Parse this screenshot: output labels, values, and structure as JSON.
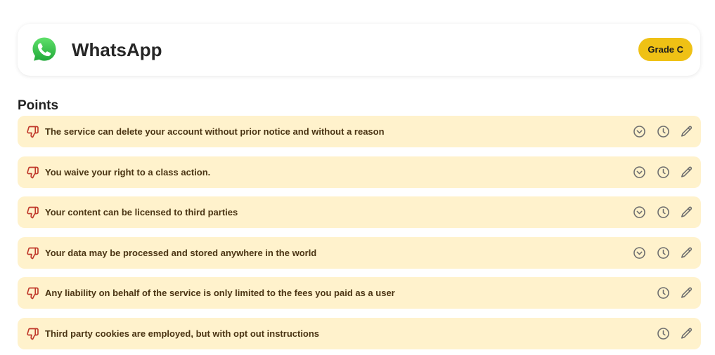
{
  "service": {
    "name": "WhatsApp",
    "grade": "Grade C",
    "logo_icon": "whatsapp-logo-icon",
    "brand_color": "#3ecb55"
  },
  "section": {
    "title": "Points"
  },
  "colors": {
    "row_background": "#fff2cc",
    "point_text": "#4a3413",
    "thumb_down": "#c0392b",
    "grade_badge": "#efc115",
    "action_icon": "#6f6f6f"
  },
  "points": [
    {
      "text": "The service can delete your account without prior notice and without a reason",
      "icon": "thumbs-down-icon",
      "expandable": true
    },
    {
      "text": "You waive your right to a class action.",
      "icon": "thumbs-down-icon",
      "expandable": true
    },
    {
      "text": "Your content can be licensed to third parties",
      "icon": "thumbs-down-icon",
      "expandable": true
    },
    {
      "text": "Your data may be processed and stored anywhere in the world",
      "icon": "thumbs-down-icon",
      "expandable": true
    },
    {
      "text": "Any liability on behalf of the service is only limited to the fees you paid as a user",
      "icon": "thumbs-down-icon",
      "expandable": false
    },
    {
      "text": "Third party cookies are employed, but with opt out instructions",
      "icon": "thumbs-down-icon",
      "expandable": false
    }
  ]
}
